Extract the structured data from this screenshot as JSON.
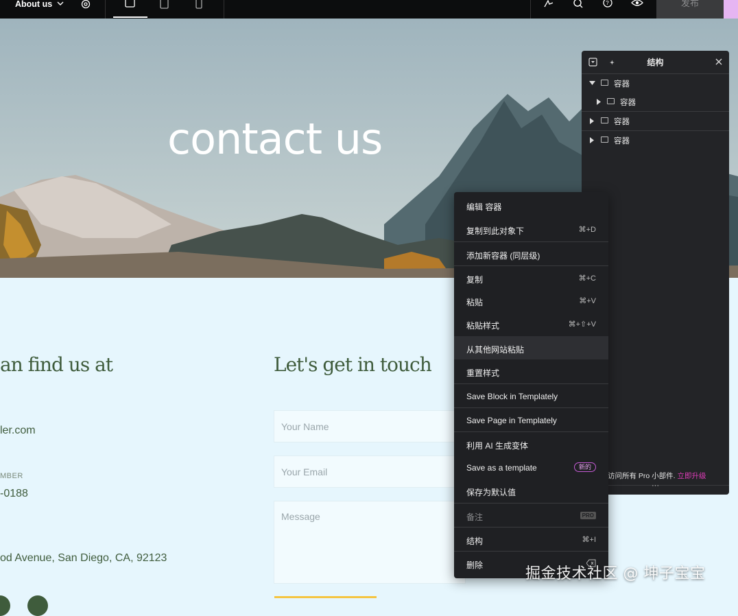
{
  "topbar": {
    "page_title": "About us",
    "publish_label": "发布"
  },
  "hero": {
    "title": "contact us"
  },
  "content": {
    "left_heading": "an find us at",
    "email_partial": "ler.com",
    "phone_label_partial": "MBER",
    "phone_partial": "-0188",
    "address_partial": "od Avenue, San Diego, CA, 92123",
    "right_heading": "Let's get in touch",
    "name_placeholder": "Your Name",
    "email_placeholder": "Your Email",
    "message_placeholder": "Message"
  },
  "structure_panel": {
    "title": "结构",
    "items": [
      {
        "label": "容器",
        "expanded": true
      },
      {
        "label": "容器",
        "expanded": false
      },
      {
        "label": "容器",
        "expanded": false
      },
      {
        "label": "容器",
        "expanded": false
      }
    ],
    "footer_text": "访问所有 Pro 小部件.",
    "footer_link": "立即升级"
  },
  "context_menu": {
    "items": [
      {
        "label": "编辑 容器",
        "shortcut": ""
      },
      {
        "label": "复制到此对象下",
        "shortcut": "⌘+D"
      },
      {
        "label": "添加新容器 (同层级)",
        "shortcut": ""
      },
      {
        "label": "复制",
        "shortcut": "⌘+C"
      },
      {
        "label": "粘贴",
        "shortcut": "⌘+V"
      },
      {
        "label": "粘贴样式",
        "shortcut": "⌘+⇧+V"
      },
      {
        "label": "从其他网站粘贴",
        "shortcut": ""
      },
      {
        "label": "重置样式",
        "shortcut": ""
      },
      {
        "label": "Save Block in Templately",
        "shortcut": ""
      },
      {
        "label": "Save Page in Templately",
        "shortcut": ""
      },
      {
        "label": "利用 AI 生成变体",
        "shortcut": ""
      },
      {
        "label": "Save as a template",
        "shortcut": "",
        "badge": "新的"
      },
      {
        "label": "保存为默认值",
        "shortcut": ""
      },
      {
        "label": "备注",
        "shortcut": "",
        "badge": "PRO"
      },
      {
        "label": "结构",
        "shortcut": "⌘+I"
      },
      {
        "label": "删除",
        "shortcut": ""
      }
    ]
  },
  "watermark": "掘金技术社区 @ 坤子宝宝"
}
